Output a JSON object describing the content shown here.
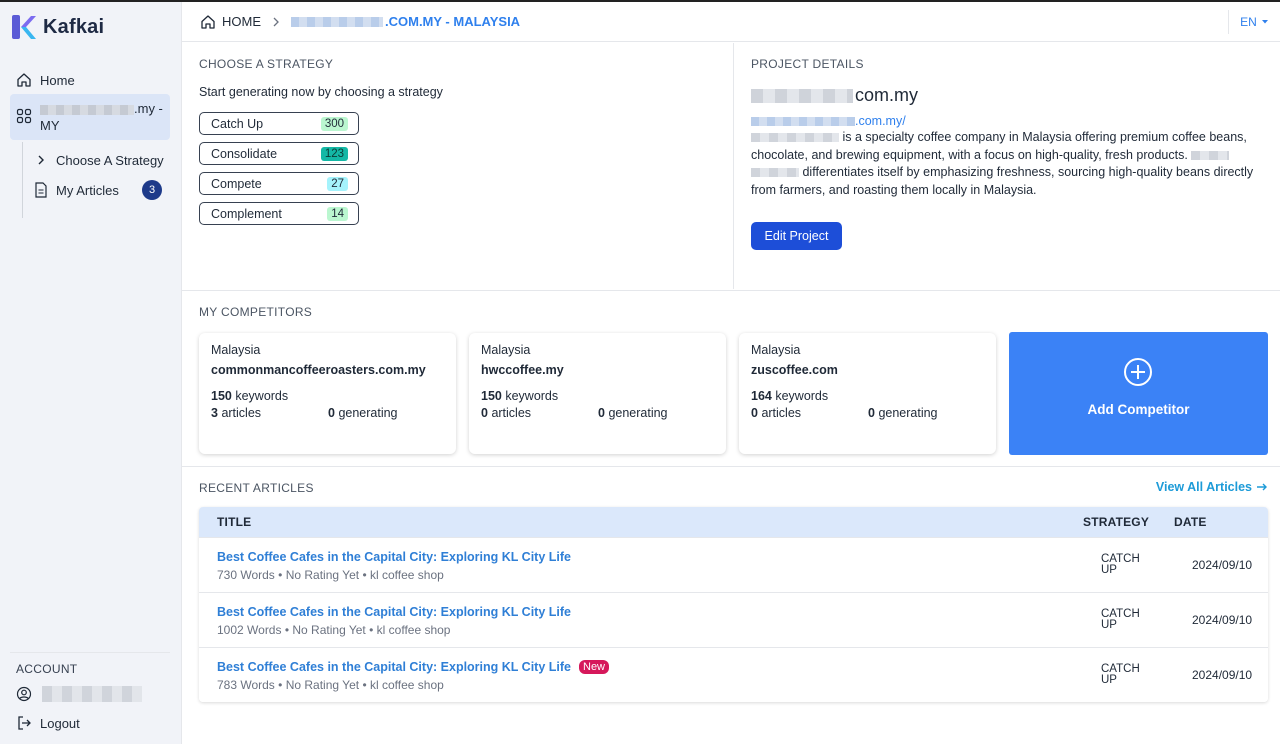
{
  "app": {
    "name": "Kafkai"
  },
  "sidebar": {
    "home_label": "Home",
    "project_label_suffix": ".my -",
    "project_label_line2": "MY",
    "sub_items": [
      {
        "label": "Choose A Strategy"
      },
      {
        "label": "My Articles",
        "count": "3"
      }
    ],
    "account_label": "ACCOUNT",
    "logout_label": "Logout"
  },
  "topbar": {
    "home_label": "HOME",
    "site_label": ".COM.MY - MALAYSIA",
    "lang": "EN"
  },
  "strategy": {
    "heading": "CHOOSE A STRATEGY",
    "intro": "Start generating now by choosing a strategy",
    "options": [
      {
        "label": "Catch Up",
        "count": "300",
        "color": "#bbf7d0"
      },
      {
        "label": "Consolidate",
        "count": "123",
        "color": "#0f766e"
      },
      {
        "label": "Compete",
        "count": "27",
        "color": "#a5f3fc"
      },
      {
        "label": "Complement",
        "count": "14",
        "color": "#bbf7d0"
      }
    ]
  },
  "project": {
    "heading": "PROJECT DETAILS",
    "domain_suffix": "com.my",
    "url_suffix": ".com.my/",
    "desc_1": "is a specialty coffee company in Malaysia offering premium coffee beans, chocolate, and brewing equipment, with a focus on high-quality, fresh products.",
    "desc_2": "differentiates itself by emphasizing freshness, sourcing high-quality beans directly from farmers, and roasting them locally in Malaysia.",
    "edit_label": "Edit Project"
  },
  "competitors": {
    "heading": "MY COMPETITORS",
    "items": [
      {
        "country": "Malaysia",
        "domain": "commonmancoffeeroasters.com.my",
        "keywords": "150",
        "keywords_label": "keywords",
        "articles": "3",
        "articles_label": "articles",
        "generating": "0",
        "generating_label": "generating"
      },
      {
        "country": "Malaysia",
        "domain": "hwccoffee.my",
        "keywords": "150",
        "keywords_label": "keywords",
        "articles": "0",
        "articles_label": "articles",
        "generating": "0",
        "generating_label": "generating"
      },
      {
        "country": "Malaysia",
        "domain": "zuscoffee.com",
        "keywords": "164",
        "keywords_label": "keywords",
        "articles": "0",
        "articles_label": "articles",
        "generating": "0",
        "generating_label": "generating"
      }
    ],
    "add_label": "Add Competitor"
  },
  "recent": {
    "heading": "RECENT ARTICLES",
    "view_all": "View All Articles",
    "columns": {
      "title": "TITLE",
      "strategy": "STRATEGY",
      "date": "DATE"
    },
    "rows": [
      {
        "title": "Best Coffee Cafes in the Capital City: Exploring KL City Life",
        "words": "730 Words",
        "rating": "No Rating Yet",
        "keyword": "kl coffee shop",
        "strategy_1": "CATCH",
        "strategy_2": "UP",
        "date": "2024/09/10",
        "badge": ""
      },
      {
        "title": "Best Coffee Cafes in the Capital City: Exploring KL City Life",
        "words": "1002 Words",
        "rating": "No Rating Yet",
        "keyword": "kl coffee shop",
        "strategy_1": "CATCH",
        "strategy_2": "UP",
        "date": "2024/09/10",
        "badge": ""
      },
      {
        "title": "Best Coffee Cafes in the Capital City: Exploring KL City Life",
        "words": "783 Words",
        "rating": "No Rating Yet",
        "keyword": "kl coffee shop",
        "strategy_1": "CATCH",
        "strategy_2": "UP",
        "date": "2024/09/10",
        "badge": "New"
      }
    ],
    "meta_separator": "•"
  },
  "colors": {
    "primary": "#1d4ed8",
    "accent": "#3b82f6",
    "link": "#2f80ed",
    "badge_new": "#d6185b"
  }
}
